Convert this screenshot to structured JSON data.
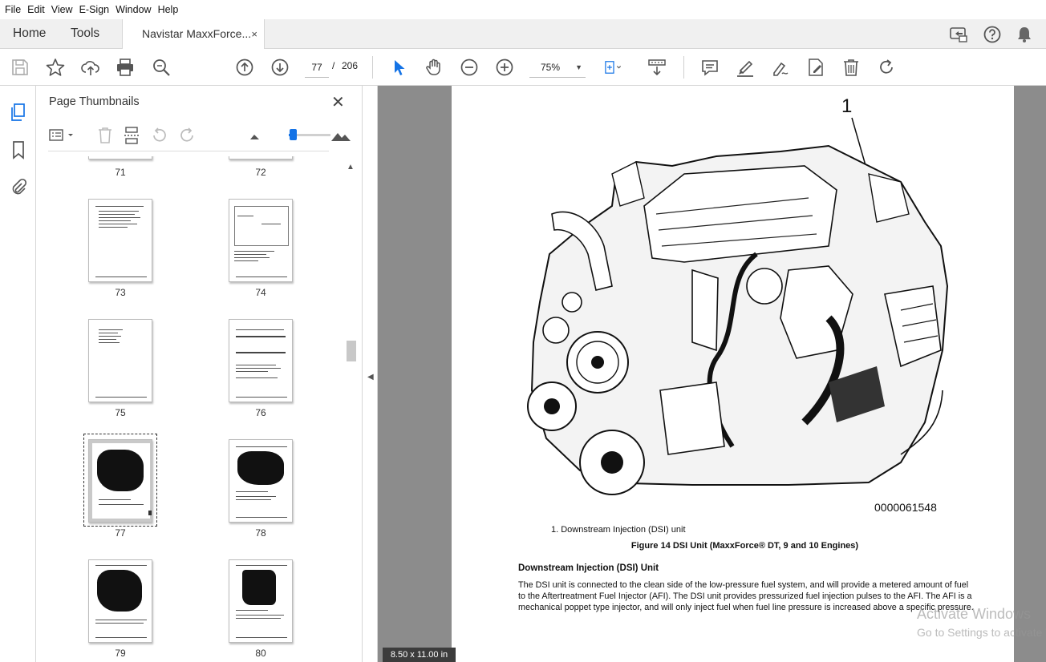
{
  "menu": [
    "File",
    "Edit",
    "View",
    "E-Sign",
    "Window",
    "Help"
  ],
  "tabs": {
    "home": "Home",
    "tools": "Tools",
    "document": "Navistar MaxxForce...",
    "close": "×"
  },
  "toolbar": {
    "current_page": "77",
    "page_separator": "/",
    "total_pages": "206",
    "zoom": "75%",
    "zoom_caret": "▼"
  },
  "panel": {
    "title": "Page Thumbnails",
    "close": "✕",
    "thumbnail_size_fraction": 0.1,
    "thumbnails": [
      {
        "label": "71"
      },
      {
        "label": "72"
      },
      {
        "label": "73"
      },
      {
        "label": "74"
      },
      {
        "label": "75"
      },
      {
        "label": "76"
      },
      {
        "label": "77",
        "selected": true
      },
      {
        "label": "78"
      },
      {
        "label": "79"
      },
      {
        "label": "80"
      }
    ]
  },
  "document": {
    "callout": "1",
    "figure_id": "0000061548",
    "legend_item": "1. Downstream Injection (DSI) unit",
    "caption": "Figure 14    DSI Unit (MaxxForce® DT, 9 and 10 Engines)",
    "heading": "Downstream Injection (DSI) Unit",
    "paragraph": "The DSI unit is connected to the clean side of the low-pressure fuel system, and will provide a metered amount of fuel to the Aftertreatment Fuel Injector (AFI). The DSI unit provides pressurized fuel injection pulses to the AFI. The AFI is a mechanical poppet type injector, and will only inject fuel when fuel line pressure is increased above a specific pressure.",
    "page_size": "8.50 x 11.00 in"
  },
  "watermark": {
    "line1": "Activate Windows",
    "line2": "Go to Settings to activate Windows."
  },
  "colors": {
    "accent": "#1473e6",
    "panel_bg": "#ffffff",
    "doc_bg": "#8c8c8c"
  }
}
